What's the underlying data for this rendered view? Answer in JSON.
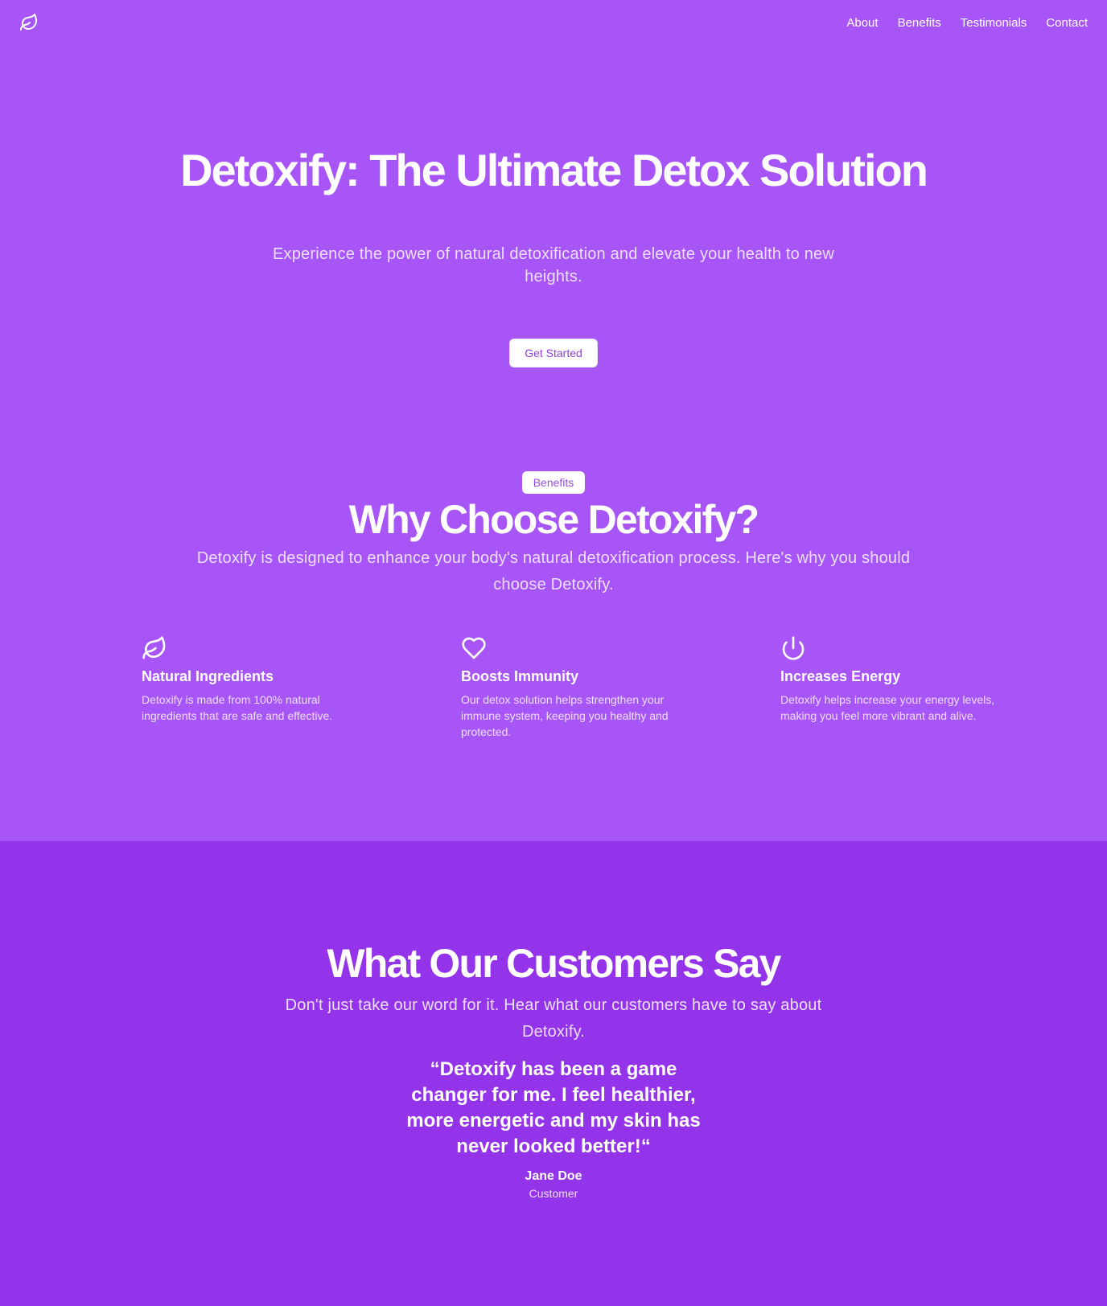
{
  "header": {
    "logo_icon": "leaf-icon",
    "nav": [
      {
        "label": "About"
      },
      {
        "label": "Benefits"
      },
      {
        "label": "Testimonials"
      },
      {
        "label": "Contact"
      }
    ]
  },
  "hero": {
    "title": "Detoxify: The Ultimate Detox Solution",
    "subtitle": "Experience the power of natural detoxification and elevate your health to new heights.",
    "cta_label": "Get Started"
  },
  "benefits": {
    "badge": "Benefits",
    "title": "Why Choose Detoxify?",
    "subtitle": "Detoxify is designed to enhance your body's natural detoxification process. Here's why you should choose Detoxify.",
    "features": [
      {
        "icon": "leaf-icon",
        "title": "Natural Ingredients",
        "text": "Detoxify is made from 100% natural ingredients that are safe and effective."
      },
      {
        "icon": "heart-icon",
        "title": "Boosts Immunity",
        "text": "Our detox solution helps strengthen your immune system, keeping you healthy and protected."
      },
      {
        "icon": "power-icon",
        "title": "Increases Energy",
        "text": "Detoxify helps increase your energy levels, making you feel more vibrant and alive."
      }
    ]
  },
  "testimonials": {
    "title": "What Our Customers Say",
    "subtitle": "Don't just take our word for it. Hear what our customers have to say about Detoxify.",
    "quote": "“Detoxify has been a game changer for me. I feel healthier, more energetic and my skin has never looked better!“",
    "author": "Jane Doe",
    "role": "Customer"
  },
  "colors": {
    "hero_bg": "#a855f7",
    "testimonials_bg": "#9333ea",
    "accent_text": "#9b4ddf"
  }
}
